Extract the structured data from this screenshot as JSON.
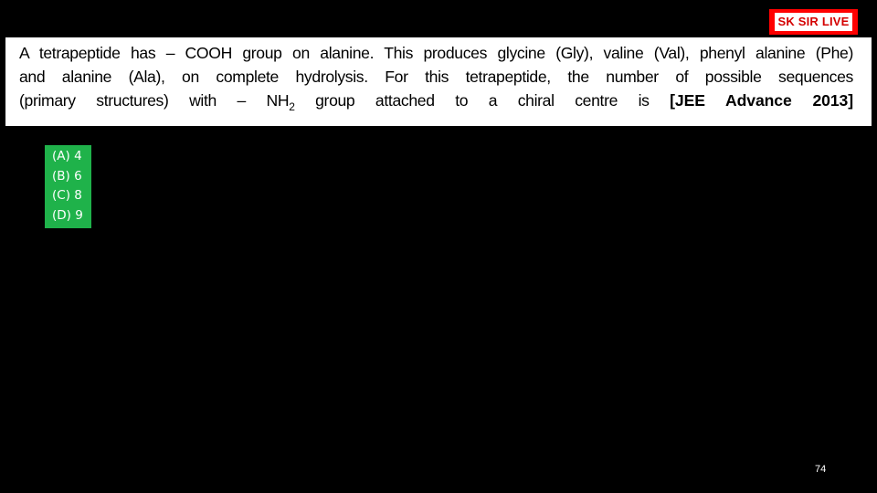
{
  "brand": {
    "label": "SK SIR LIVE"
  },
  "question": {
    "line1": "A tetrapeptide has – COOH group on alanine. This produces glycine (Gly), valine (Val), phenyl alanine (Phe)",
    "line2": "and alanine (Ala), on complete hydrolysis. For this tetrapeptide, the number of possible sequences",
    "line3_before_sub": "(primary structures) with – NH",
    "line3_sub": "2",
    "line3_after_sub": " group attached to a chiral centre is",
    "source": "[JEE Advance 2013]"
  },
  "options": [
    {
      "label": "(A)",
      "value": "4"
    },
    {
      "label": "(B)",
      "value": "6"
    },
    {
      "label": "(C)",
      "value": "8"
    },
    {
      "label": "(D)",
      "value": "9"
    }
  ],
  "page_number": "74",
  "colors": {
    "background": "#000000",
    "brand_red": "#ff0000",
    "options_green": "#1fb24a",
    "question_bg": "#ffffff"
  }
}
